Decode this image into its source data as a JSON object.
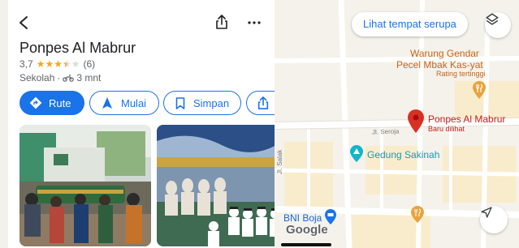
{
  "place": {
    "name": "Ponpes Al Mabrur",
    "rating": "3,7",
    "stars_value": 3.5,
    "review_count": "(6)",
    "category": "Sekolah",
    "travel_time": "3 mnt",
    "separator": "·"
  },
  "actions": {
    "route": "Rute",
    "start": "Mulai",
    "save": "Simpan"
  },
  "map": {
    "similar_places_button": "Lihat tempat serupa",
    "poi_warung_line1": "Warung Gendar",
    "poi_warung_line2": "Pecel Mbak Kas-yat",
    "poi_warung_note": "Rating tertinggi",
    "pin_name": "Ponpes Al Mabrur",
    "pin_note": "Baru dilihat",
    "street_seroja": "Jl. Seroja",
    "street_salak": "Jl. Salak",
    "poi_gedung": "Gedung Sakinah",
    "poi_bni": "BNI Boja",
    "logo": "Google"
  },
  "colors": {
    "accent": "#1a73e8",
    "pin": "#ea4335",
    "poi_food": "#e8710a",
    "poi_building": "#12b5cb",
    "poi_bank": "#1a73e8"
  }
}
